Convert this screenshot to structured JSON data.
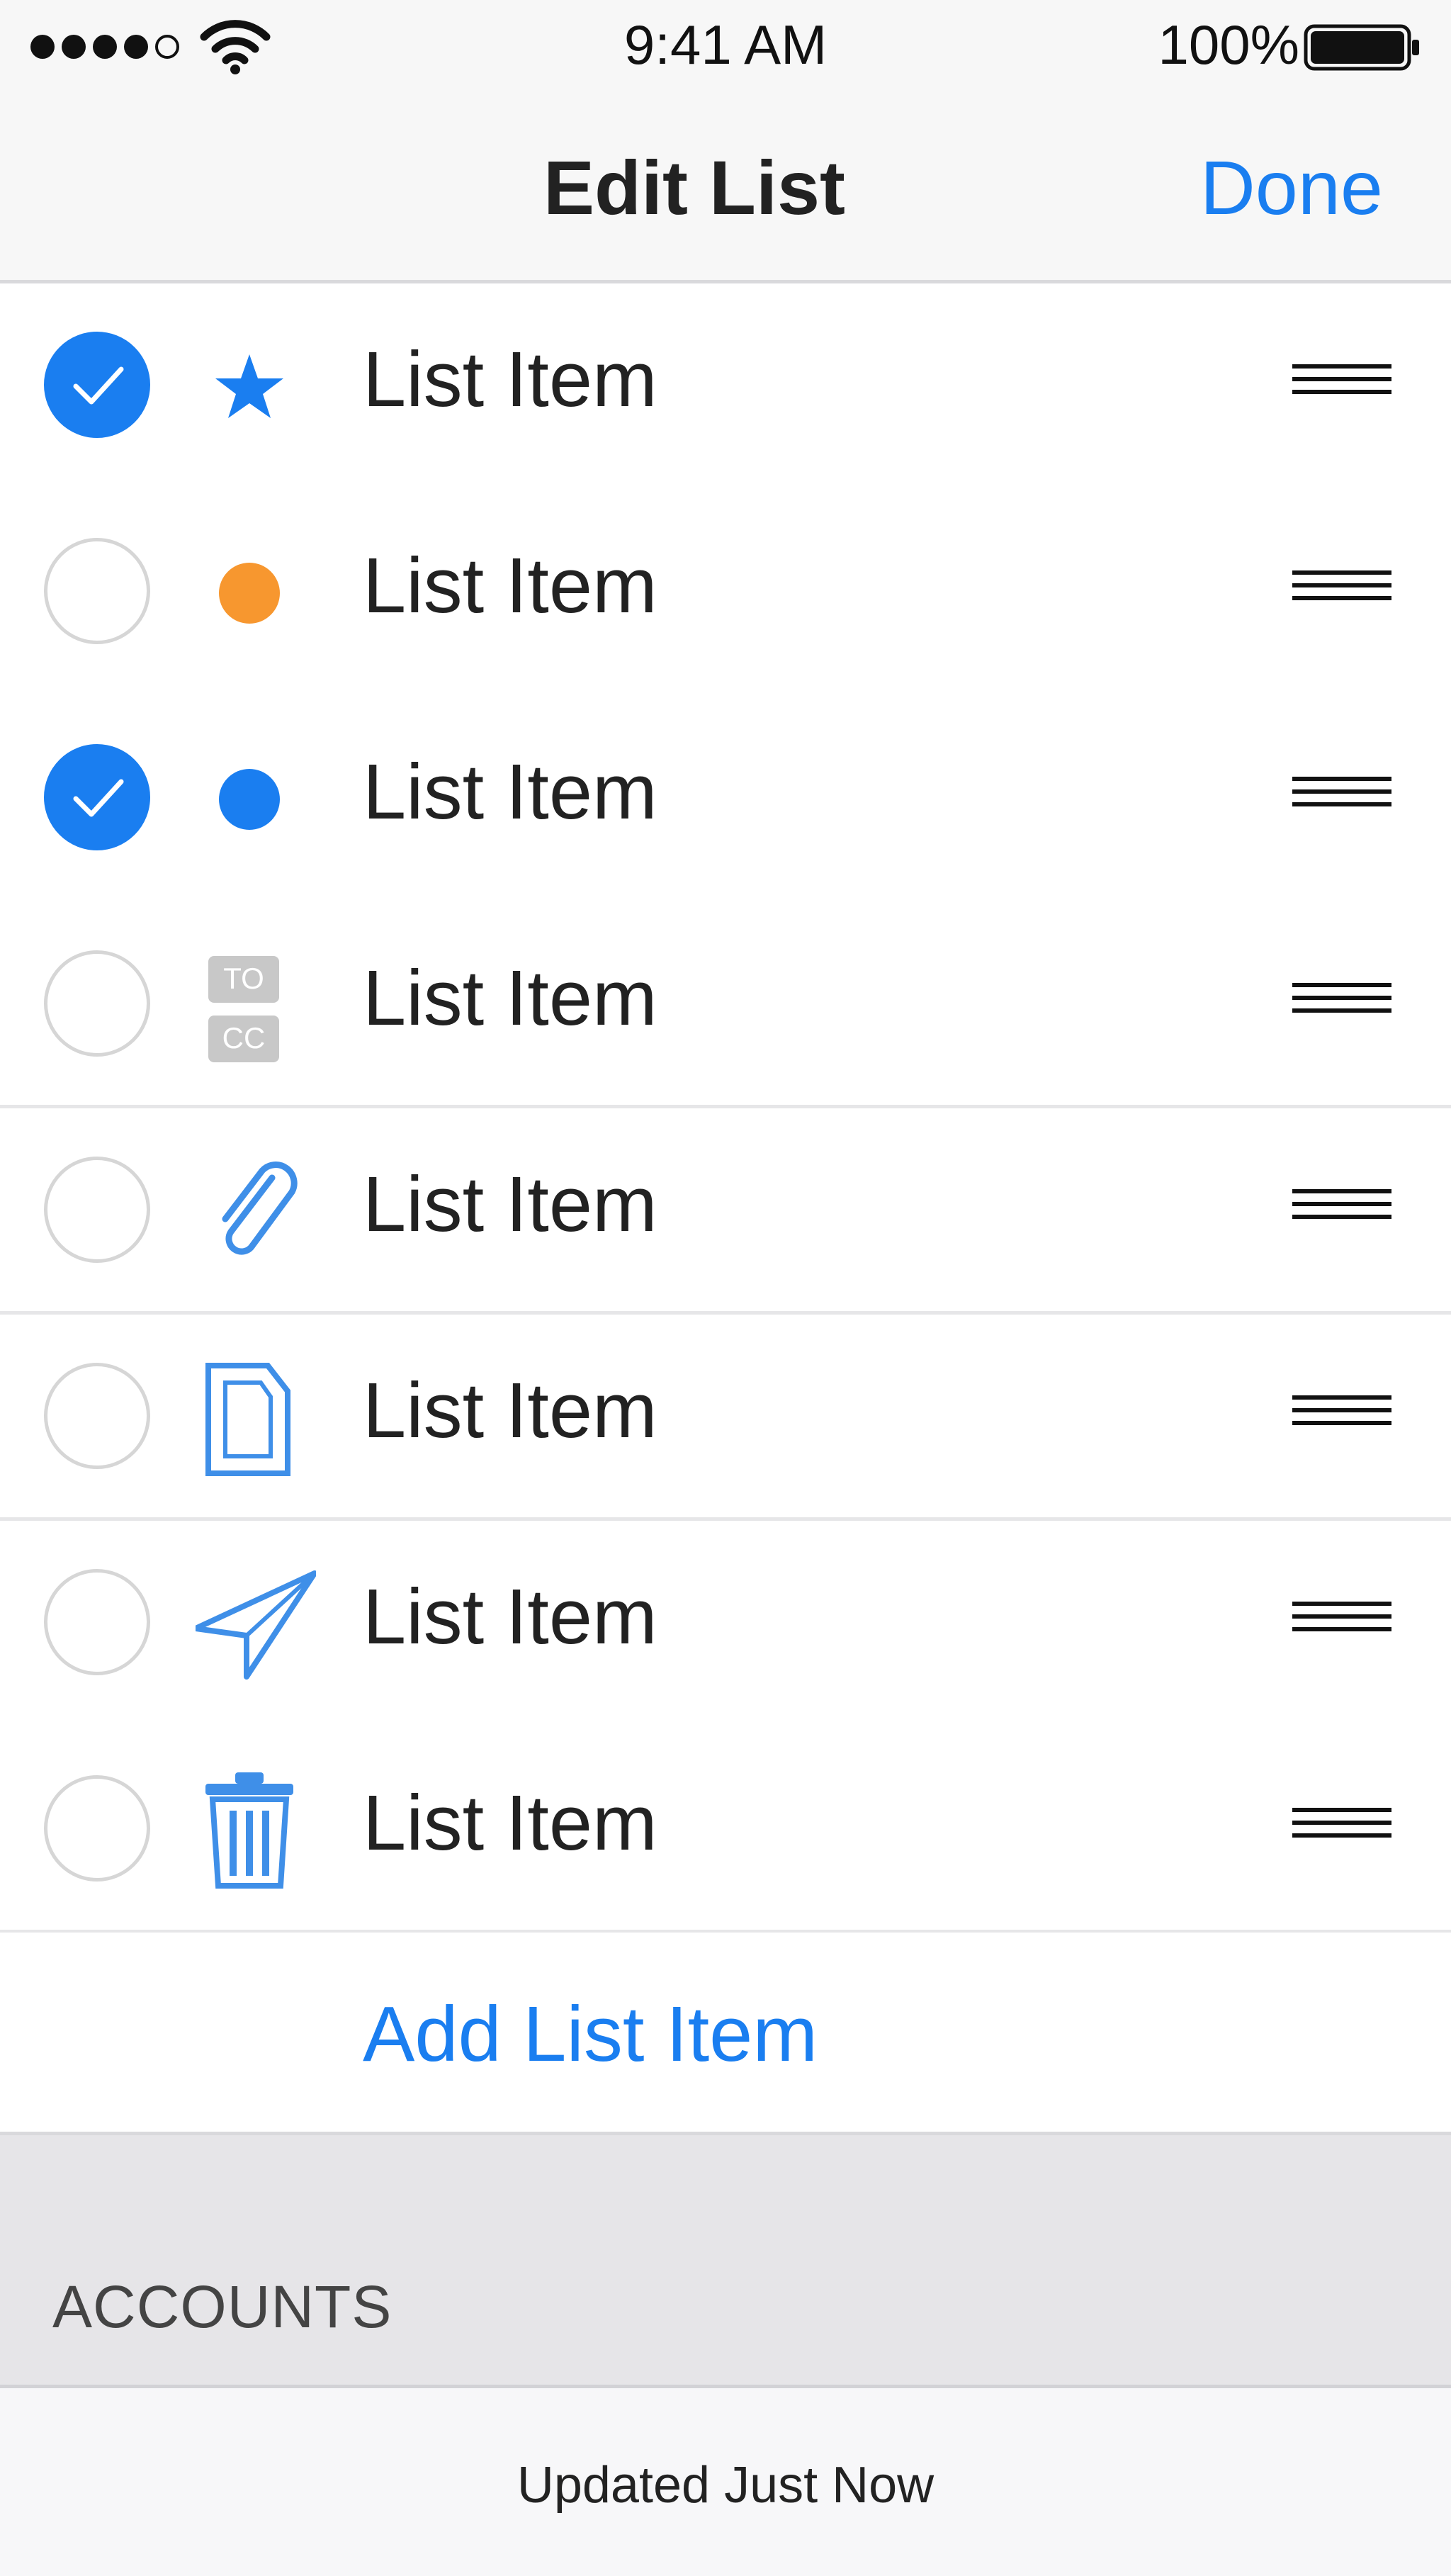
{
  "status_bar": {
    "time": "9:41 AM",
    "battery_percent": "100%",
    "signal_dots_filled": 4,
    "signal_dots_total": 5,
    "wifi_icon": "wifi-icon",
    "battery_icon": "battery-full-icon"
  },
  "nav": {
    "title": "Edit List",
    "done_label": "Done"
  },
  "list": {
    "items": [
      {
        "label": "List Item",
        "checked": true,
        "icon": "star-icon",
        "icon_color": "#1a7ef0"
      },
      {
        "label": "List Item",
        "checked": false,
        "icon": "orange-dot-icon",
        "icon_color": "#f7972f"
      },
      {
        "label": "List Item",
        "checked": true,
        "icon": "blue-dot-icon",
        "icon_color": "#1a7ef0"
      },
      {
        "label": "List Item",
        "checked": false,
        "icon": "to-cc-icon",
        "icon_color": "#c8c8c8",
        "icon_text_top": "TO",
        "icon_text_bottom": "CC"
      },
      {
        "label": "List Item",
        "checked": false,
        "icon": "paperclip-icon",
        "icon_color": "#3f8fe8"
      },
      {
        "label": "List Item",
        "checked": false,
        "icon": "document-icon",
        "icon_color": "#3f8fe8"
      },
      {
        "label": "List Item",
        "checked": false,
        "icon": "paper-plane-icon",
        "icon_color": "#3f8fe8"
      },
      {
        "label": "List Item",
        "checked": false,
        "icon": "trash-icon",
        "icon_color": "#3f8fe8"
      }
    ],
    "reorder_icon": "reorder-grip-icon",
    "add_label": "Add List Item"
  },
  "section": {
    "title": "ACCOUNTS"
  },
  "footer": {
    "status": "Updated Just Now"
  },
  "colors": {
    "accent": "#1a7ef0",
    "orange": "#f7972f",
    "bar_background": "#f7f7f7",
    "section_background": "#e6e5e8"
  }
}
